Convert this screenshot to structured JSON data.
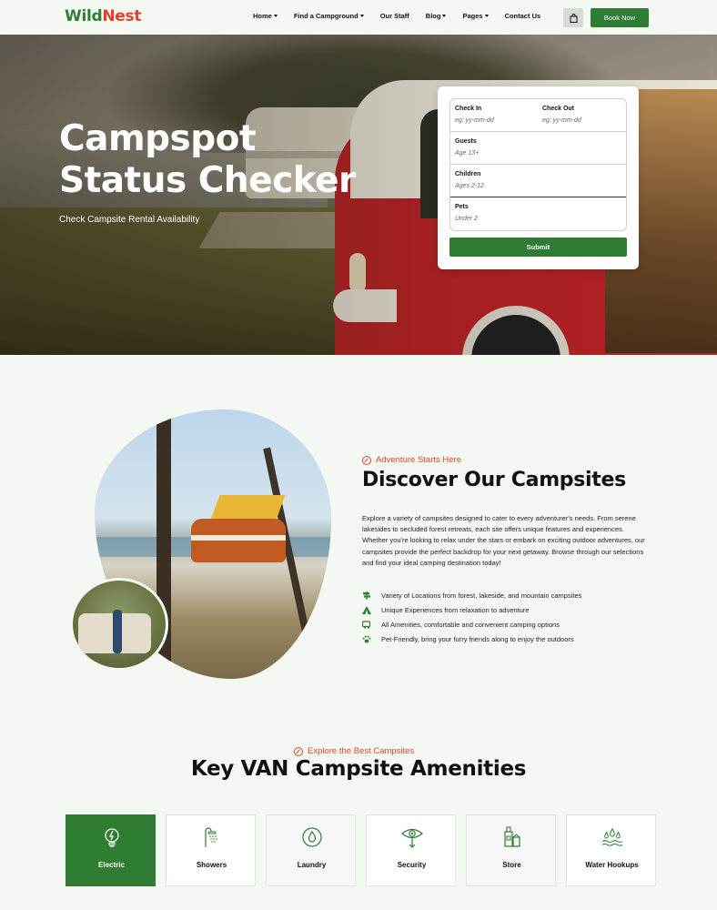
{
  "brand": {
    "part1": "Wild",
    "part2": "Nest",
    "green": "#2f7d32",
    "red": "#e2402b"
  },
  "nav": {
    "items": [
      {
        "label": "Home",
        "dropdown": true
      },
      {
        "label": "Find a Campground",
        "dropdown": true
      },
      {
        "label": "Our Staff",
        "dropdown": false
      },
      {
        "label": "Blog",
        "dropdown": true
      },
      {
        "label": "Pages",
        "dropdown": true
      },
      {
        "label": "Contact Us",
        "dropdown": false
      }
    ],
    "cart_icon": "shopping-bag-icon",
    "book_label": "Book Now"
  },
  "hero": {
    "title_line1": "Campspot",
    "title_line2": "Status Checker",
    "subtitle": "Check Campsite Rental Availability"
  },
  "form": {
    "check_in": {
      "label": "Check In",
      "placeholder": "eg: yy-mm-dd"
    },
    "check_out": {
      "label": "Check Out",
      "placeholder": "eg: yy-mm-dd"
    },
    "guests": {
      "label": "Guests",
      "placeholder": "Age 13+"
    },
    "children": {
      "label": "Children",
      "placeholder": "Ages 2-12"
    },
    "pets": {
      "label": "Pets",
      "placeholder": "Under 2"
    },
    "submit_label": "Submit"
  },
  "discover": {
    "eyebrow": "Adventure Starts Here",
    "title": "Discover Our Campsites",
    "paragraph": "Explore a variety of campsites designed to cater to every adventurer's needs. From serene lakesides to secluded forest retreats, each site offers unique features and experiences. Whether you're looking to relax under the stars or embark on exciting outdoor adventures, our campsites provide the perfect backdrop for your next getaway. Browse through our selections and find your ideal camping destination today!",
    "features": [
      {
        "icon": "signpost-icon",
        "text": "Variety of Locations from forest, lakeside, and mountain campsites"
      },
      {
        "icon": "tent-icon",
        "text": "Unique Experiences from relaxation to adventure"
      },
      {
        "icon": "camper-icon",
        "text": "All Amenities, comfortable and convenient camping options"
      },
      {
        "icon": "paw-icon",
        "text": "Pet-Friendly, bring your furry friends along to enjoy the outdoors"
      }
    ]
  },
  "amenities": {
    "eyebrow": "Explore the Best Campsites",
    "title": "Key VAN Campsite Amenities",
    "cards": [
      {
        "label": "Electric",
        "icon": "lightbulb-icon",
        "active": true
      },
      {
        "label": "Showers",
        "icon": "shower-icon",
        "active": false
      },
      {
        "label": "Laundry",
        "icon": "laundry-icon",
        "active": false
      },
      {
        "label": "Security",
        "icon": "eye-icon",
        "active": false
      },
      {
        "label": "Store",
        "icon": "store-icon",
        "active": false
      },
      {
        "label": "Water Hookups",
        "icon": "water-icon",
        "active": false
      }
    ]
  }
}
